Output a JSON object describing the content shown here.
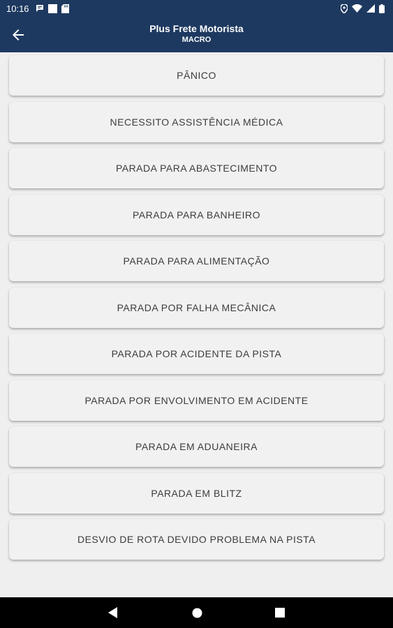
{
  "status_bar": {
    "time": "10:16",
    "left_icons": [
      "message-icon",
      "square-notification-icon",
      "sd-card-icon"
    ],
    "right_icons": [
      "location-icon",
      "wifi-icon",
      "signal-icon",
      "battery-icon"
    ]
  },
  "app_bar": {
    "title": "Plus Frete Motorista",
    "subtitle": "MACRO",
    "background_color": "#1e3960"
  },
  "macros": [
    {
      "label": "PÂNICO"
    },
    {
      "label": "NECESSITO ASSISTÊNCIA MÉDICA"
    },
    {
      "label": "PARADA PARA ABASTECIMENTO"
    },
    {
      "label": "PARADA PARA BANHEIRO"
    },
    {
      "label": "PARADA PARA ALIMENTAÇÃO"
    },
    {
      "label": "PARADA POR FALHA MECÂNICA"
    },
    {
      "label": "PARADA POR ACIDENTE DA PISTA"
    },
    {
      "label": "PARADA POR ENVOLVIMENTO EM ACIDENTE"
    },
    {
      "label": "PARADA EM ADUANEIRA"
    },
    {
      "label": "PARADA EM BLITZ"
    },
    {
      "label": "DESVIO DE ROTA DEVIDO PROBLEMA NA PISTA"
    }
  ],
  "nav_bar": {
    "buttons": [
      "back-triangle-icon",
      "home-circle-icon",
      "recents-square-icon"
    ]
  }
}
